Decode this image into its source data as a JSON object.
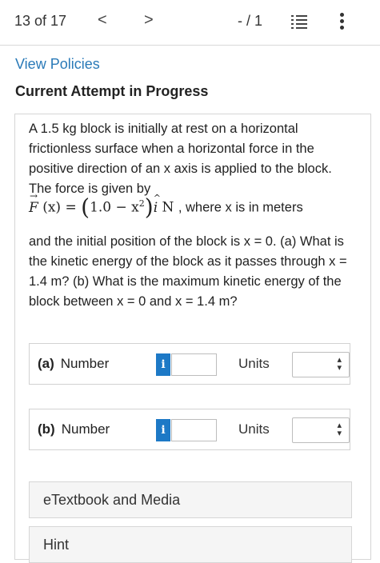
{
  "topbar": {
    "counter": "13 of 17",
    "prev_icon": "chevron-left-icon",
    "prev_glyph": "<",
    "next_icon": "chevron-right-icon",
    "next_glyph": ">",
    "page_count": "- / 1",
    "list_icon": "list-icon",
    "more_icon": "more-vertical-icon"
  },
  "view_policies": "View Policies",
  "heading": "Current Attempt in Progress",
  "problem": {
    "text_before": "A 1.5 kg block is initially at rest on a horizontal frictionless surface when a horizontal force in the positive direction of an x axis is applied to the block. The force is given by",
    "math": {
      "F": "F",
      "x_paren": "(x)",
      "eq": "=",
      "open": "(",
      "inner": "1.0 − x",
      "exp": "2",
      "close": ")",
      "i": "i",
      "unit": "N",
      "tail": ", where x is in meters"
    },
    "text_after": "and the initial position of the block is x = 0. (a) What is the kinetic energy of the block as it passes through x = 1.4 m? (b) What is the maximum kinetic energy of the block between x = 0 and x = 1.4 m?"
  },
  "answers": [
    {
      "part": "(a)",
      "label": "Number",
      "info": "i",
      "value": "",
      "units_label": "Units",
      "units_selected": ""
    },
    {
      "part": "(b)",
      "label": "Number",
      "info": "i",
      "value": "",
      "units_label": "Units",
      "units_selected": ""
    }
  ],
  "panels": {
    "etextbook": "eTextbook and Media",
    "hint": "Hint"
  },
  "colors": {
    "link": "#2a7ab8",
    "info_button": "#1d79c6",
    "panel_background": "#f5f5f5"
  }
}
